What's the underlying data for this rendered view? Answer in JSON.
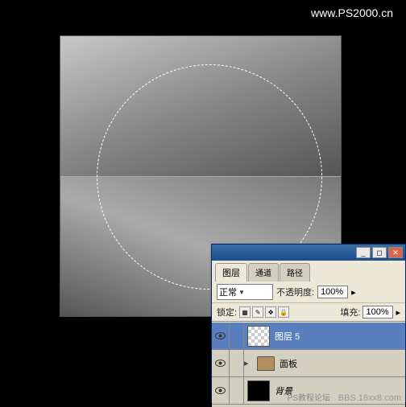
{
  "watermark_top": "www.PS2000.cn",
  "watermark_left": "PS教程论坛",
  "watermark_right": "BBS.16xx8.com",
  "tabs": {
    "layers": "图层",
    "channels": "通道",
    "paths": "路径"
  },
  "blend": {
    "mode": "正常",
    "opacity_label": "不透明度:",
    "opacity": "100%"
  },
  "lock": {
    "label": "锁定:",
    "fill_label": "填充:",
    "fill": "100%"
  },
  "layers": [
    {
      "name": "图层 5",
      "type": "trans",
      "selected": true
    },
    {
      "name": "面板",
      "type": "folder",
      "selected": false
    },
    {
      "name": "背景",
      "type": "black",
      "selected": false
    }
  ]
}
